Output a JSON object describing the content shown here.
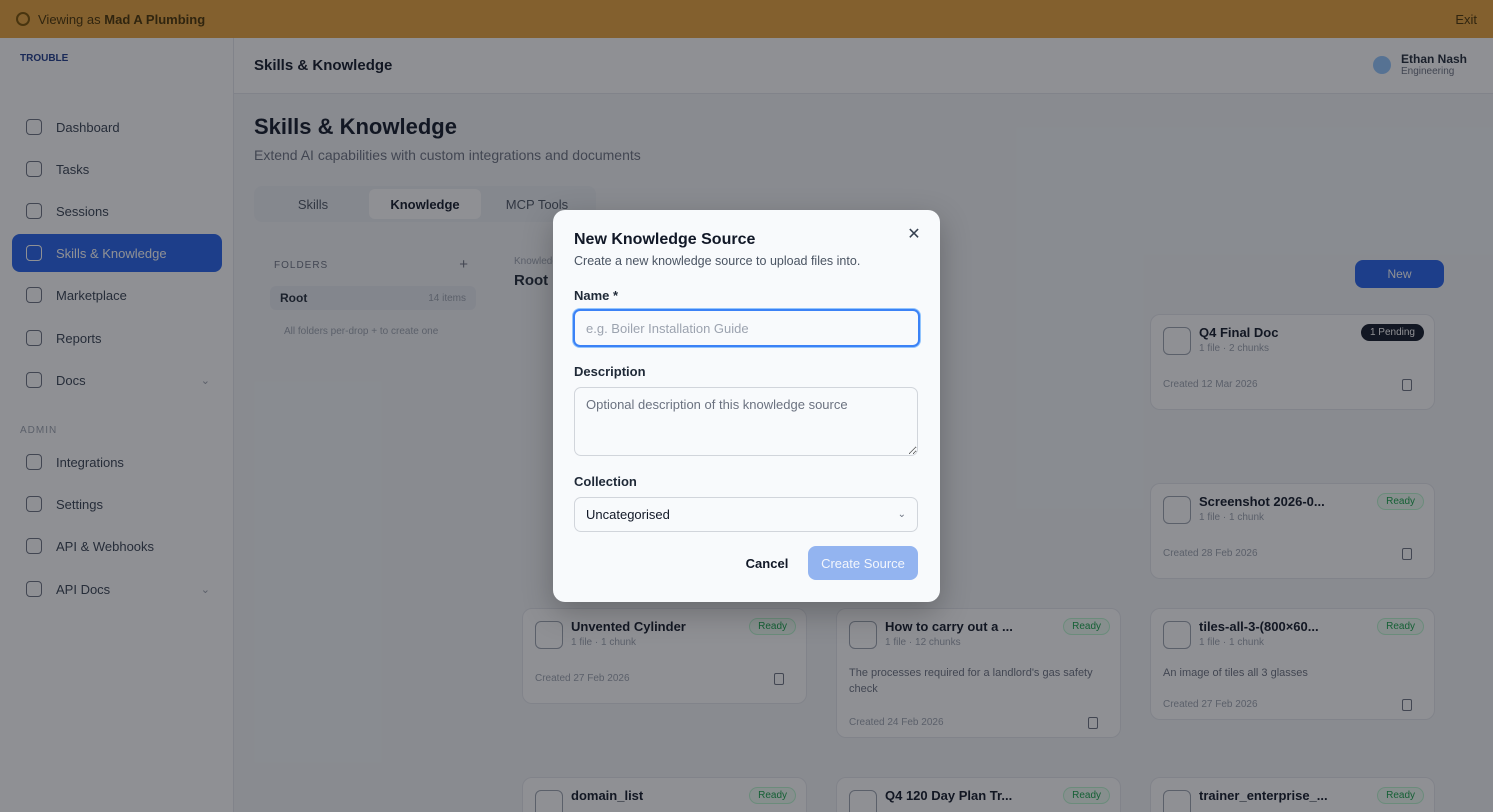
{
  "banner": {
    "text_prefix": "Viewing as",
    "text_name": "Mad A Plumbing",
    "exit_label": "Exit"
  },
  "sidebar": {
    "logo": "TROUBLE",
    "items": [
      {
        "label": "Dashboard"
      },
      {
        "label": "Tasks"
      },
      {
        "label": "Sessions"
      },
      {
        "label": "Skills & Knowledge"
      },
      {
        "label": "Marketplace"
      },
      {
        "label": "Reports"
      },
      {
        "label": "Docs"
      }
    ],
    "section_label": "ADMIN",
    "admin_items": [
      {
        "label": "Integrations"
      },
      {
        "label": "Settings"
      },
      {
        "label": "API & Webhooks"
      },
      {
        "label": "API Docs"
      }
    ]
  },
  "header": {
    "breadcrumb": "Skills & Knowledge",
    "user_name": "Ethan Nash",
    "user_role": "Engineering"
  },
  "main": {
    "title": "Skills & Knowledge",
    "subtitle": "Extend AI capabilities with custom integrations and documents",
    "tabs": [
      "Skills",
      "Knowledge",
      "MCP Tools"
    ],
    "folders_label": "FOLDERS",
    "root_folder": "Root",
    "root_count": "14 items",
    "folder_hint": "All folders per-drop + to create one",
    "breadcrumb_small": "Knowledge",
    "current_folder": "Root",
    "new_button": "New"
  },
  "cards": [
    {
      "title": "Q4 Final Doc",
      "meta": "1 file · 2 chunks",
      "badge": "1 Pending",
      "created": "Created 12 Mar 2026"
    },
    {
      "title": "Screenshot 2026-0...",
      "meta": "1 file · 1 chunk",
      "badge": "Ready",
      "created": "Created 28 Feb 2026"
    },
    {
      "title": "Unvented Cylinder",
      "meta": "1 file · 1 chunk",
      "badge": "Ready",
      "created": "Created 27 Feb 2026"
    },
    {
      "title": "How to carry out a ...",
      "meta": "1 file · 12 chunks",
      "badge": "Ready",
      "desc": "The processes required for a landlord's gas safety check",
      "created": "Created 24 Feb 2026"
    },
    {
      "title": "tiles-all-3-(800×60...",
      "meta": "1 file · 1 chunk",
      "badge": "Ready",
      "desc": "An image of tiles all 3 glasses",
      "created": "Created 27 Feb 2026"
    },
    {
      "title": "domain_list",
      "badge": "Ready"
    },
    {
      "title": "Q4 120 Day Plan Tr...",
      "badge": "Ready"
    },
    {
      "title": "trainer_enterprise_...",
      "badge": "Ready"
    }
  ],
  "modal": {
    "title": "New Knowledge Source",
    "subtitle": "Create a new knowledge source to upload files into.",
    "close_glyph": "✕",
    "name_label": "Name *",
    "name_placeholder": "e.g. Boiler Installation Guide",
    "name_value": "",
    "description_label": "Description",
    "description_placeholder": "Optional description of this knowledge source",
    "collection_label": "Collection",
    "collection_value": "Uncategorised",
    "cancel_label": "Cancel",
    "create_label": "Create Source"
  }
}
